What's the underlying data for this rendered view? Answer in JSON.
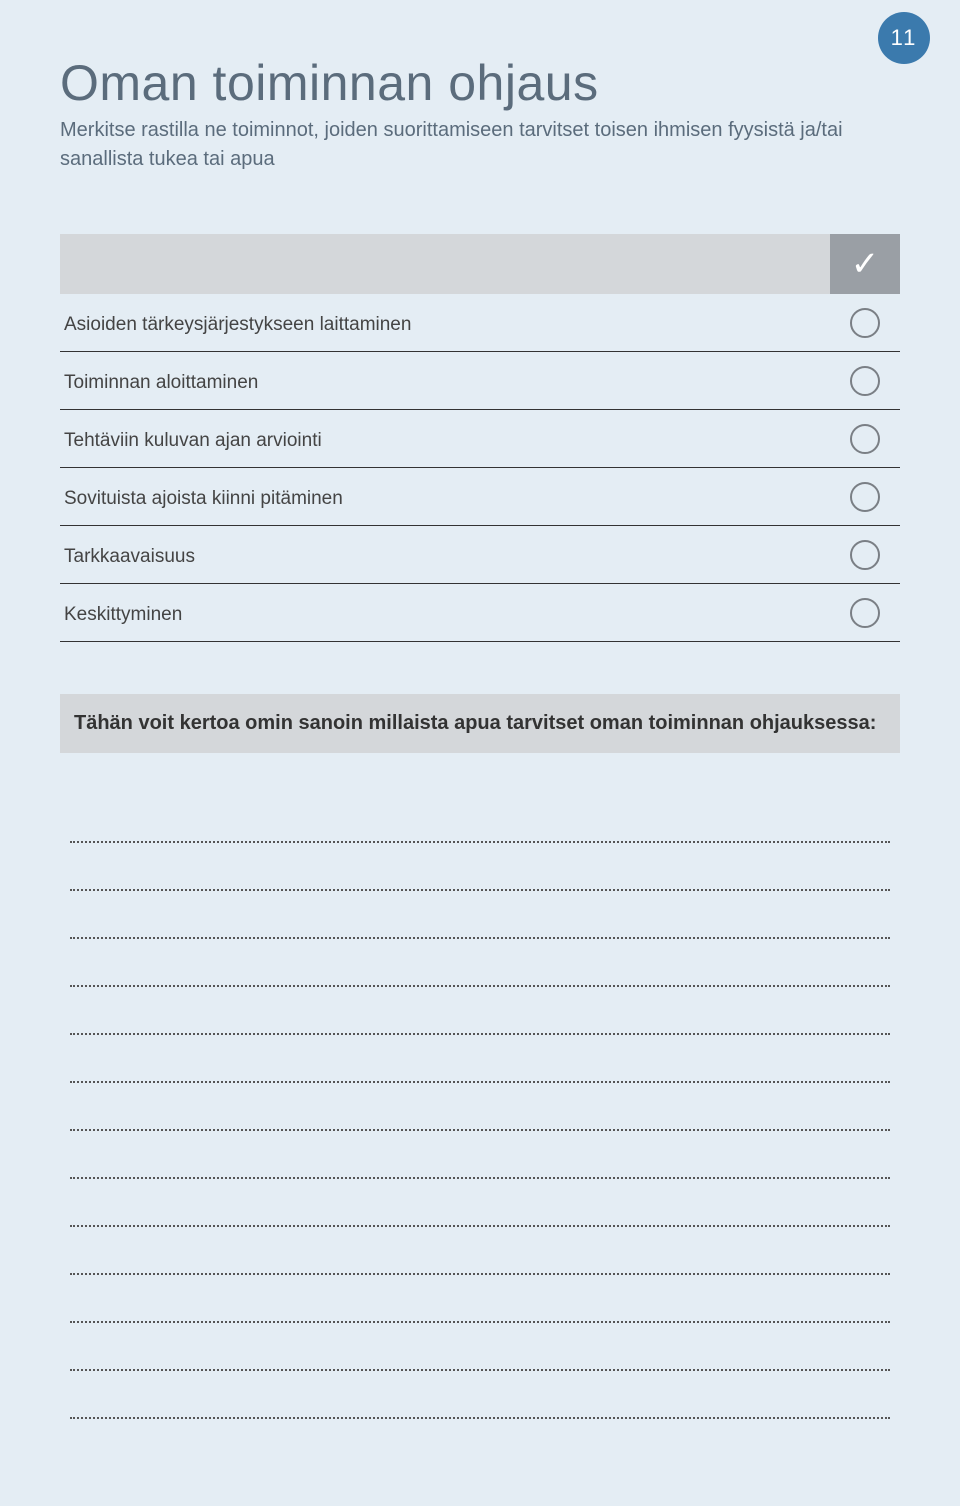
{
  "page_number": "11",
  "title": "Oman toiminnan ohjaus",
  "subtitle": "Merkitse rastilla ne toiminnot, joiden suorittamiseen tarvitset toisen ihmisen fyysistä ja/tai sanallista tukea tai apua",
  "check_mark": "✓",
  "items": [
    "Asioiden tärkeysjärjestykseen laittaminen",
    "Toiminnan aloittaminen",
    "Tehtäviin kuluvan ajan arviointi",
    "Sovituista ajoista kiinni pitäminen",
    "Tarkkaavaisuus",
    "Keskittyminen"
  ],
  "prompt": "Tähän voit kertoa omin sanoin millaista apua tarvitset oman toiminnan ohjauksessa:",
  "line_count": 13
}
